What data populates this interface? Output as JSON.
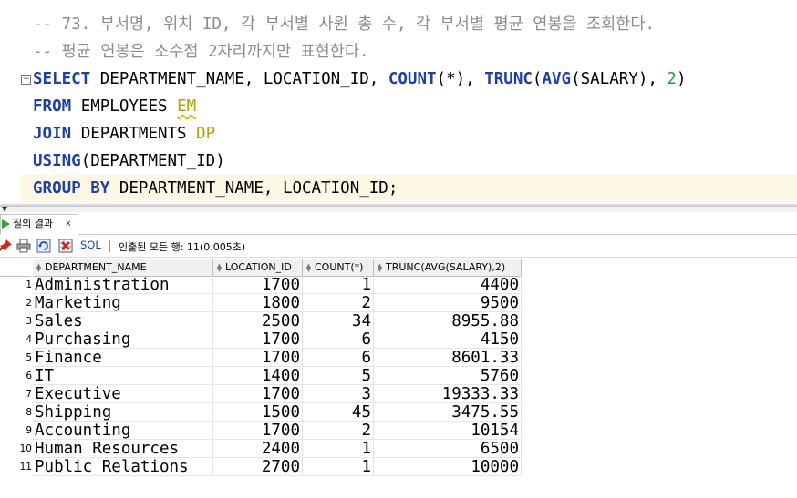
{
  "editor": {
    "comment_lines": [
      "-- 73. 부서명, 위치 ID, 각 부서별 사원 총 수, 각 부서별 평균 연봉을 조회한다.",
      "-- 평균 연봉은 소수점 2자리까지만 표현한다."
    ],
    "sql": {
      "select_kw": "SELECT",
      "select_cols": " DEPARTMENT_NAME, LOCATION_ID, ",
      "count_fn": "COUNT",
      "count_arg": "(*), ",
      "trunc_fn": "TRUNC",
      "paren_open": "(",
      "avg_fn": "AVG",
      "avg_arg": "(SALARY), ",
      "two": "2",
      "paren_close": ")",
      "from_kw": "FROM",
      "from_table": " EMPLOYEES ",
      "from_alias": "EM",
      "join_kw": "JOIN",
      "join_table": " DEPARTMENTS ",
      "join_alias": "DP",
      "using_kw": "USING",
      "using_arg": "(DEPARTMENT_ID)",
      "group_kw": "GROUP BY",
      "group_cols": " DEPARTMENT_NAME, LOCATION_ID;"
    },
    "fold_icon": "minus-box-icon"
  },
  "results_tab": {
    "label": "질의 결과",
    "close": "x"
  },
  "toolbar": {
    "sql_label": "SQL",
    "fetched_text": "인출된 모든 행: 11(0.005초)"
  },
  "grid": {
    "columns": [
      "DEPARTMENT_NAME",
      "LOCATION_ID",
      "COUNT(*)",
      "TRUNC(AVG(SALARY),2)"
    ],
    "rows": [
      [
        "1",
        "Administration",
        "1700",
        "1",
        "4400"
      ],
      [
        "2",
        "Marketing",
        "1800",
        "2",
        "9500"
      ],
      [
        "3",
        "Sales",
        "2500",
        "34",
        "8955.88"
      ],
      [
        "4",
        "Purchasing",
        "1700",
        "6",
        "4150"
      ],
      [
        "5",
        "Finance",
        "1700",
        "6",
        "8601.33"
      ],
      [
        "6",
        "IT",
        "1400",
        "5",
        "5760"
      ],
      [
        "7",
        "Executive",
        "1700",
        "3",
        "19333.33"
      ],
      [
        "8",
        "Shipping",
        "1500",
        "45",
        "3475.55"
      ],
      [
        "9",
        "Accounting",
        "1700",
        "2",
        "10154"
      ],
      [
        "10",
        "Human Resources",
        "2400",
        "1",
        "6500"
      ],
      [
        "11",
        "Public Relations",
        "2700",
        "1",
        "10000"
      ]
    ]
  }
}
